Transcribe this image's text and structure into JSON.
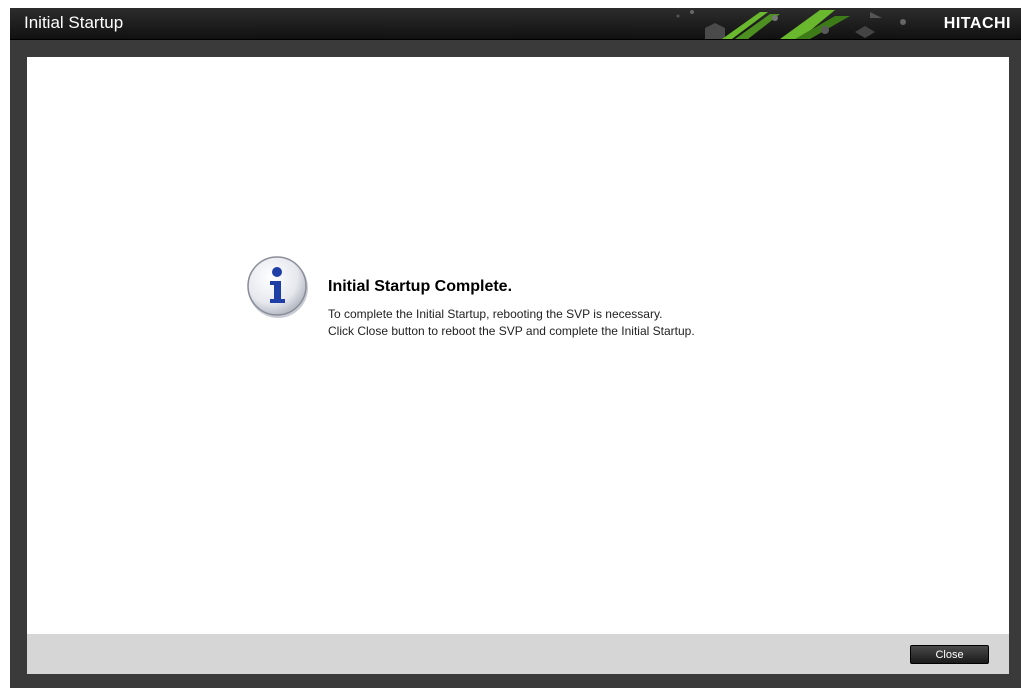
{
  "window": {
    "title": "Initial Startup",
    "brand": "HITACHI"
  },
  "message": {
    "icon": "info-icon",
    "title": "Initial Startup Complete.",
    "lines": [
      "To complete the Initial Startup, rebooting the SVP is necessary.",
      "Click Close button to reboot the SVP and complete the Initial Startup."
    ]
  },
  "footer": {
    "close_label": "Close"
  },
  "colors": {
    "titlebar": "#1a1a1a",
    "frame": "#3a3a3a",
    "content_bg": "#ffffff",
    "footer_bg": "#d6d6d6",
    "icon_blue": "#1f3fa6",
    "accent_green": "#6ab82e"
  }
}
